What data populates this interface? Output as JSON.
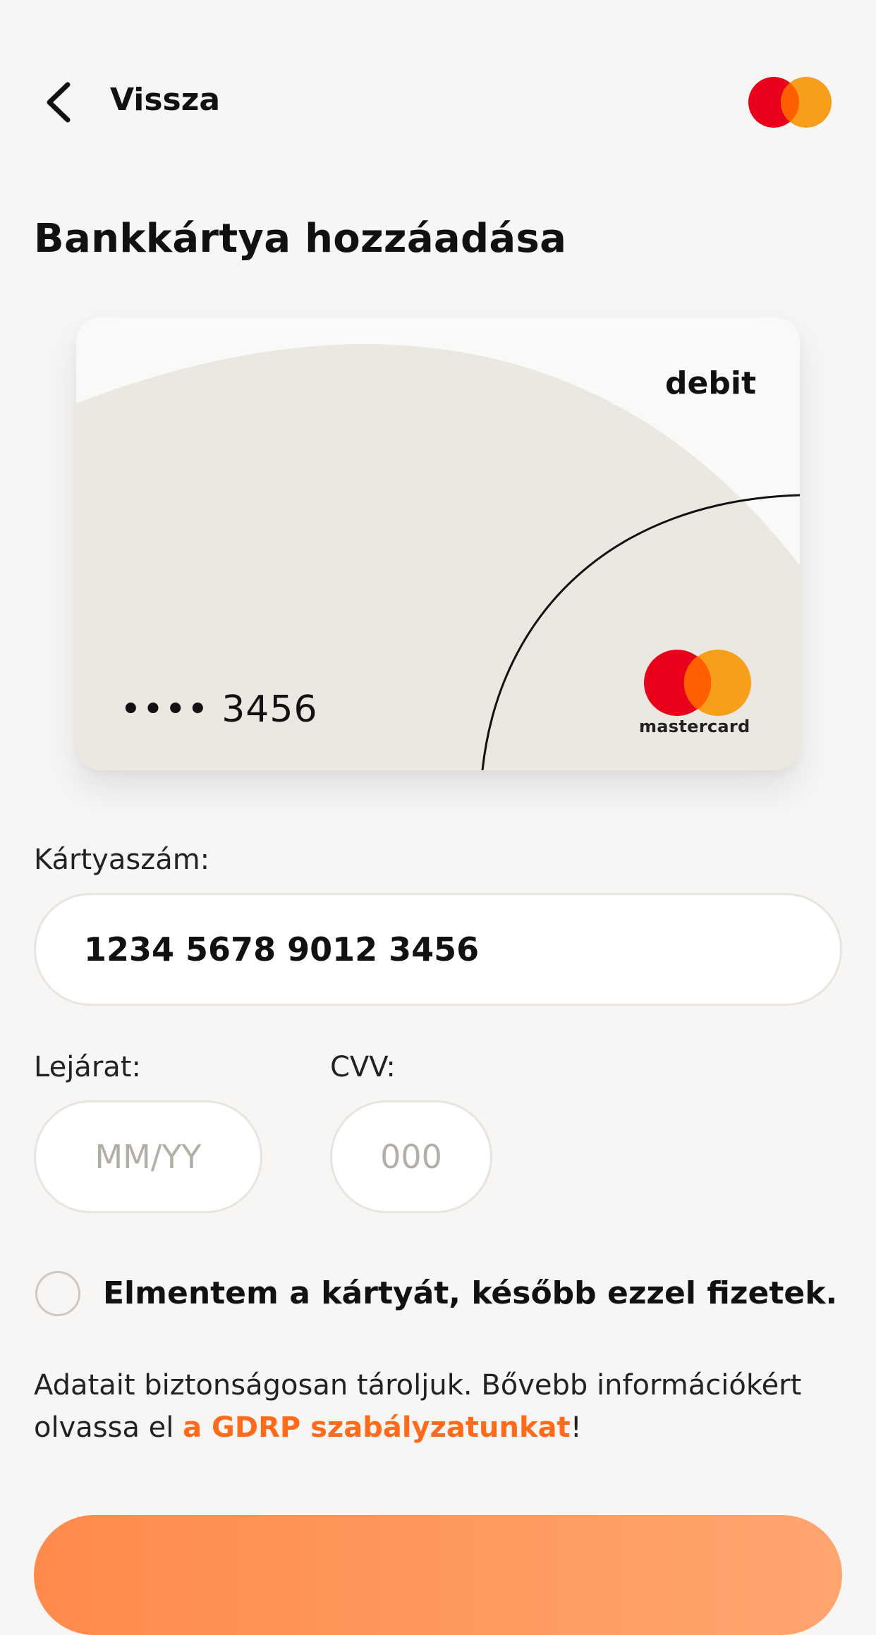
{
  "header": {
    "back_label": "Vissza",
    "brand_logo": "mastercard-logo"
  },
  "page": {
    "title": "Bankkártya hozzáadása"
  },
  "card_preview": {
    "type_label": "debit",
    "masked_number": "•••• 3456",
    "network_label": "mastercard",
    "network_logo": "mastercard-logo"
  },
  "form": {
    "card_number_label": "Kártyaszám:",
    "card_number_value": "1234 5678 9012 3456",
    "expiry_label": "Lejárat:",
    "expiry_placeholder": "MM/YY",
    "cvv_label": "CVV:",
    "cvv_placeholder": "000",
    "save_card_label": "Elmentem a kártyát, később ezzel fizetek.",
    "save_card_checked": false
  },
  "info": {
    "text_before": "Adatait biztonságosan tároljuk. Bővebb információkért olvassa el ",
    "link_text": "a GDRP szabályzatunkat",
    "text_after": "!"
  },
  "colors": {
    "accent": "#ff6b1a",
    "button_gradient_start": "#ff8a4c",
    "button_gradient_end": "#ffa56f",
    "background": "#f7f6f4",
    "card_beige": "#ebe7e1",
    "mc_red": "#eb001b",
    "mc_orange": "#f79e1b"
  }
}
